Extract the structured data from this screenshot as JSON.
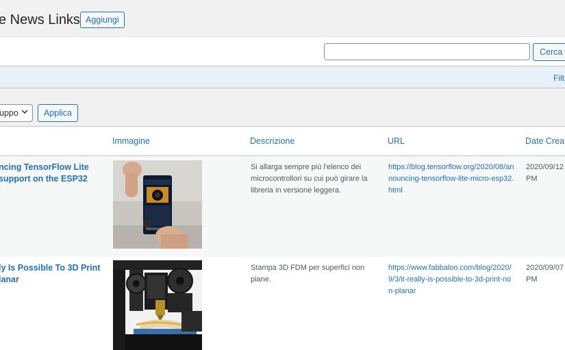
{
  "header": {
    "title": "e News Links",
    "add_button": "Aggiungi"
  },
  "search": {
    "value": "",
    "button": "Cerca N"
  },
  "filter_bar": {
    "link": "Filtr"
  },
  "bulk_actions": {
    "selected": "uppo",
    "apply_button": "Applica"
  },
  "table": {
    "columns": {
      "image": "Immagine",
      "description": "Descrizione",
      "url": "URL",
      "date": "Date Create"
    },
    "rows": [
      {
        "title_line1": "ncing TensorFlow Lite",
        "title_line2": "support on the ESP32",
        "description": "Si allarga sempre più l'elenco dei microcontrollori su cui può girare la libreria in versione leggera.",
        "url": "https://blog.tensorflow.org/2020/08/announcing-tensorflow-lite-micro-esp32.html",
        "date_line1": "2020/09/12",
        "date_line2": "PM",
        "image": "esp32-camera-board-photo"
      },
      {
        "title_line1": "ly Is Possible To 3D Print",
        "title_line2": "lanar",
        "description": "Stampa 3D FDM per superfici non piane.",
        "url": "https://www.fabbaloo.com/blog/2020/9/3/it-really-is-possible-to-3d-print-non-planar",
        "date_line1": "2020/09/07",
        "date_line2": "PM",
        "image": "3d-printer-photo"
      }
    ]
  },
  "colors": {
    "link": "#2271b1",
    "background": "#f1f1f1",
    "filter_bar": "#e8f0f7"
  }
}
